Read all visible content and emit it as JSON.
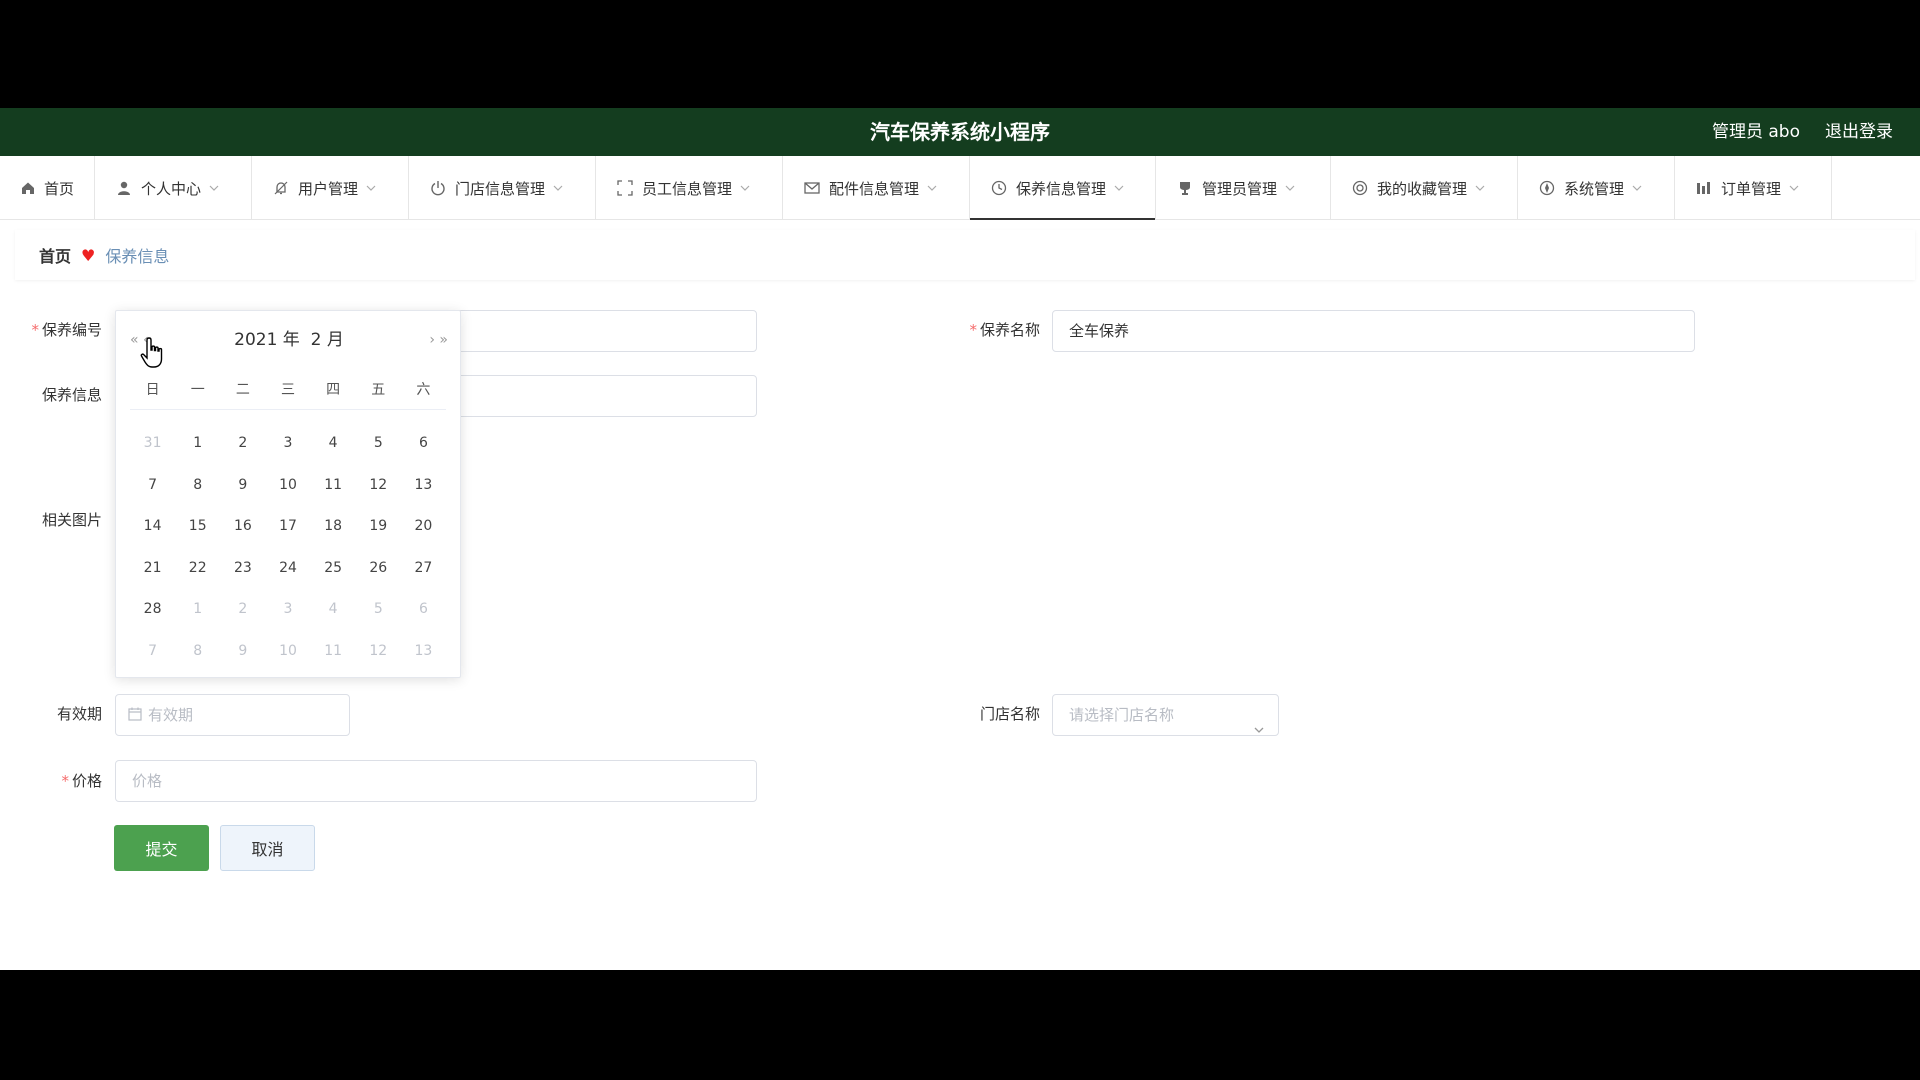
{
  "header": {
    "title": "汽车保养系统小程序",
    "user": "管理员 abo",
    "logout": "退出登录"
  },
  "nav": [
    {
      "label": "首页",
      "icon": "home-icon",
      "chevron": false
    },
    {
      "label": "个人中心",
      "icon": "user-icon",
      "chevron": true
    },
    {
      "label": "用户管理",
      "icon": "bell-icon",
      "chevron": true
    },
    {
      "label": "门店信息管理",
      "icon": "power-icon",
      "chevron": true
    },
    {
      "label": "员工信息管理",
      "icon": "fullscreen-icon",
      "chevron": true
    },
    {
      "label": "配件信息管理",
      "icon": "mail-icon",
      "chevron": true
    },
    {
      "label": "保养信息管理",
      "icon": "clock-icon",
      "chevron": true,
      "active": true
    },
    {
      "label": "管理员管理",
      "icon": "trophy-icon",
      "chevron": true
    },
    {
      "label": "我的收藏管理",
      "icon": "circle-icon",
      "chevron": true
    },
    {
      "label": "系统管理",
      "icon": "compass-icon",
      "chevron": true
    },
    {
      "label": "订单管理",
      "icon": "bars-icon",
      "chevron": true
    }
  ],
  "breadcrumb": {
    "home": "首页",
    "current": "保养信息"
  },
  "form": {
    "code_label": "保养编号",
    "name_label": "保养名称",
    "name_value": "全车保养",
    "info_label": "保养信息",
    "image_label": "相关图片",
    "validity_label": "有效期",
    "validity_placeholder": "有效期",
    "store_label": "门店名称",
    "store_placeholder": "请选择门店名称",
    "price_label": "价格",
    "price_placeholder": "价格",
    "submit": "提交",
    "cancel": "取消"
  },
  "calendar": {
    "year_label": "2021 年",
    "month_label": "2 月",
    "prev_year": "«",
    "prev_month": "‹",
    "next_month": "›",
    "next_year": "»",
    "weekdays": [
      "日",
      "一",
      "二",
      "三",
      "四",
      "五",
      "六"
    ],
    "days": [
      [
        "31",
        "other"
      ],
      [
        "1",
        ""
      ],
      [
        "2",
        ""
      ],
      [
        "3",
        ""
      ],
      [
        "4",
        ""
      ],
      [
        "5",
        ""
      ],
      [
        "6",
        ""
      ],
      [
        "7",
        ""
      ],
      [
        "8",
        ""
      ],
      [
        "9",
        ""
      ],
      [
        "10",
        ""
      ],
      [
        "11",
        ""
      ],
      [
        "12",
        ""
      ],
      [
        "13",
        ""
      ],
      [
        "14",
        ""
      ],
      [
        "15",
        ""
      ],
      [
        "16",
        ""
      ],
      [
        "17",
        ""
      ],
      [
        "18",
        ""
      ],
      [
        "19",
        ""
      ],
      [
        "20",
        ""
      ],
      [
        "21",
        ""
      ],
      [
        "22",
        ""
      ],
      [
        "23",
        ""
      ],
      [
        "24",
        ""
      ],
      [
        "25",
        ""
      ],
      [
        "26",
        ""
      ],
      [
        "27",
        ""
      ],
      [
        "28",
        ""
      ],
      [
        "1",
        "other"
      ],
      [
        "2",
        "other"
      ],
      [
        "3",
        "other"
      ],
      [
        "4",
        "other"
      ],
      [
        "5",
        "other"
      ],
      [
        "6",
        "other"
      ],
      [
        "7",
        "other"
      ],
      [
        "8",
        "other"
      ],
      [
        "9",
        "other"
      ],
      [
        "10",
        "other"
      ],
      [
        "11",
        "other"
      ],
      [
        "12",
        "other"
      ],
      [
        "13",
        "other"
      ]
    ]
  },
  "colors": {
    "header_bg": "#143d1f",
    "primary": "#4ca14f",
    "required": "#f56c6c"
  }
}
